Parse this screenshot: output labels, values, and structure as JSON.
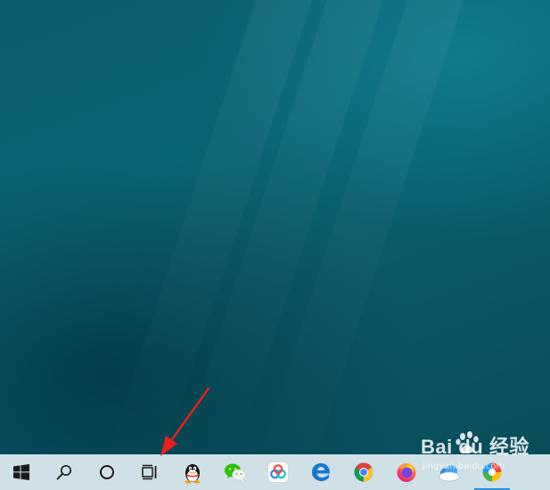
{
  "taskbar": {
    "items": [
      {
        "icon": "windows-start-icon"
      },
      {
        "icon": "search-icon"
      },
      {
        "icon": "cortana-icon"
      },
      {
        "icon": "task-view-icon"
      },
      {
        "icon": "qq-icon"
      },
      {
        "icon": "wechat-icon"
      },
      {
        "icon": "baidu-netdisk-icon"
      },
      {
        "icon": "edge-icon"
      },
      {
        "icon": "chrome-icon"
      },
      {
        "icon": "firefox-icon"
      },
      {
        "icon": "cloud-app-icon"
      },
      {
        "icon": "color-app-icon",
        "active": true
      }
    ]
  },
  "watermark": {
    "brand": "Bai du 经验",
    "url": "jingyan.baidu.com"
  },
  "colors": {
    "taskbar": "#cfe0e6",
    "wallpaper": "#0b6472",
    "arrow": "#e8201f",
    "active_indicator": "#2b8fd6"
  }
}
